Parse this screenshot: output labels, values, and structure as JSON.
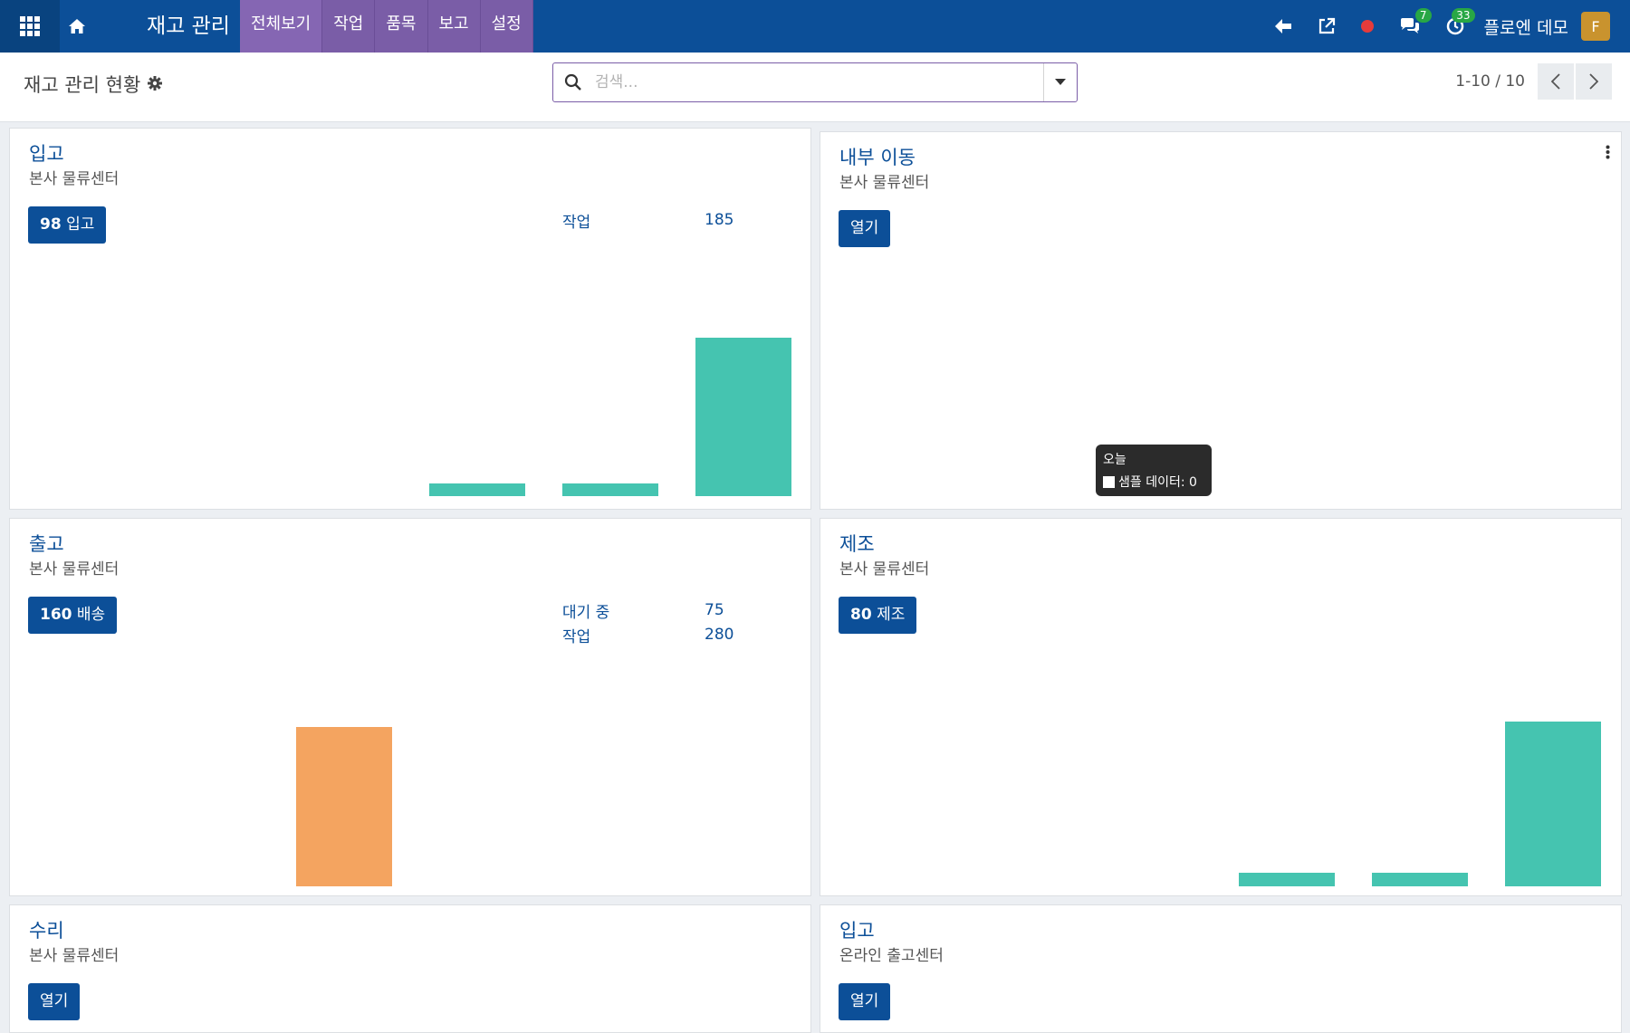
{
  "nav": {
    "brand": "재고 관리",
    "menu": [
      "전체보기",
      "작업",
      "품목",
      "보고",
      "설정"
    ],
    "messages_badge": "7",
    "activities_badge": "33",
    "user_name": "플로엔 데모",
    "avatar_letter": "F"
  },
  "control": {
    "title": "재고 관리 현황",
    "search_placeholder": "검색...",
    "pager": "1-10 / 10"
  },
  "cards": [
    {
      "title": "입고",
      "subtitle": "본사 물류센터",
      "button_count": "98",
      "button_label": "입고",
      "stats": [
        {
          "label": "작업",
          "value": "185"
        }
      ],
      "bar_color": "#45c4b0",
      "bars": [
        1,
        1,
        13.5
      ]
    },
    {
      "title": "내부 이동",
      "subtitle": "본사 물류센터",
      "button_label": "열기",
      "tooltip": {
        "title": "오늘",
        "line": "샘플 데이터: 0"
      }
    },
    {
      "title": "출고",
      "subtitle": "본사 물류센터",
      "button_count": "160",
      "button_label": "배송",
      "stats": [
        {
          "label": "대기 중",
          "value": "75"
        },
        {
          "label": "작업",
          "value": "280"
        }
      ],
      "bar_color": "#f4a460",
      "bars": [
        13.5
      ]
    },
    {
      "title": "제조",
      "subtitle": "본사 물류센터",
      "button_count": "80",
      "button_label": "제조",
      "bar_color": "#45c4b0",
      "bars": [
        1,
        1,
        14
      ]
    },
    {
      "title": "수리",
      "subtitle": "본사 물류센터",
      "button_label": "열기"
    },
    {
      "title": "입고",
      "subtitle": "온라인 출고센터",
      "button_label": "열기"
    }
  ]
}
